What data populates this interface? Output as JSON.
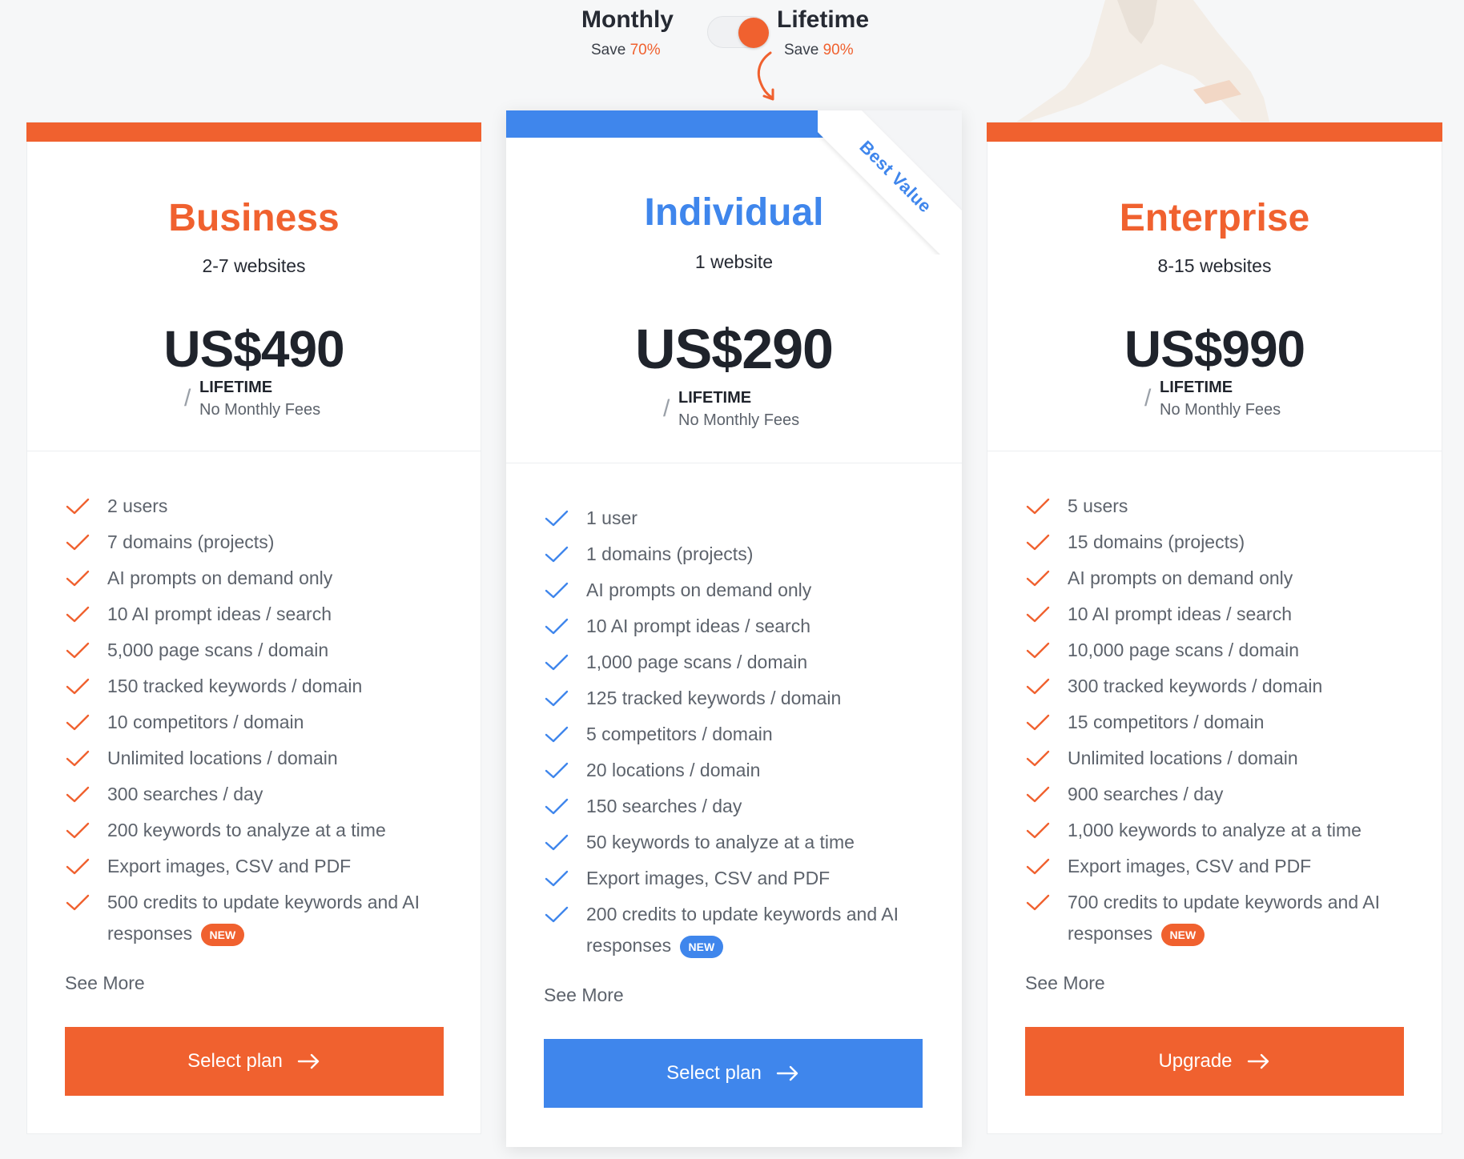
{
  "billing_toggle": {
    "monthly_label": "Monthly",
    "monthly_save_prefix": "Save ",
    "monthly_save_pct": "70%",
    "lifetime_label": "Lifetime",
    "lifetime_save_prefix": "Save ",
    "lifetime_save_pct": "90%",
    "selected": "Lifetime"
  },
  "colors": {
    "orange": "#f0612f",
    "blue": "#3f86ec"
  },
  "plans": [
    {
      "name": "Business",
      "sites": "2-7 websites",
      "price": "US$490",
      "period_slash": "/",
      "period": "LIFETIME",
      "period_note": "No Monthly Fees",
      "features": [
        "2 users",
        "7 domains (projects)",
        "AI prompts on demand only",
        "10 AI prompt ideas / search",
        "5,000 page scans / domain",
        "150 tracked keywords / domain",
        "10 competitors / domain",
        "Unlimited locations / domain",
        "300 searches / day",
        "200 keywords to analyze at a time",
        "Export images, CSV and PDF",
        "500 credits to update keywords and AI responses"
      ],
      "new_badge": "NEW",
      "see_more": "See More",
      "cta": "Select plan"
    },
    {
      "name": "Individual",
      "ribbon": "Best Value",
      "sites": "1 website",
      "price": "US$290",
      "period_slash": "/",
      "period": "LIFETIME",
      "period_note": "No Monthly Fees",
      "features": [
        "1 user",
        "1 domains (projects)",
        "AI prompts on demand only",
        "10 AI prompt ideas / search",
        "1,000 page scans / domain",
        "125 tracked keywords / domain",
        "5 competitors / domain",
        "20 locations / domain",
        "150 searches / day",
        "50 keywords to analyze at a time",
        "Export images, CSV and PDF",
        "200 credits to update keywords and AI responses"
      ],
      "new_badge": "NEW",
      "see_more": "See More",
      "cta": "Select plan"
    },
    {
      "name": "Enterprise",
      "sites": "8-15 websites",
      "price": "US$990",
      "period_slash": "/",
      "period": "LIFETIME",
      "period_note": "No Monthly Fees",
      "features": [
        "5 users",
        "15 domains (projects)",
        "AI prompts on demand only",
        "10 AI prompt ideas / search",
        "10,000 page scans / domain",
        "300 tracked keywords / domain",
        "15 competitors / domain",
        "Unlimited locations / domain",
        "900 searches / day",
        "1,000 keywords to analyze at a time",
        "Export images, CSV and PDF",
        "700 credits to update keywords and AI responses"
      ],
      "new_badge": "NEW",
      "see_more": "See More",
      "cta": "Upgrade"
    }
  ]
}
